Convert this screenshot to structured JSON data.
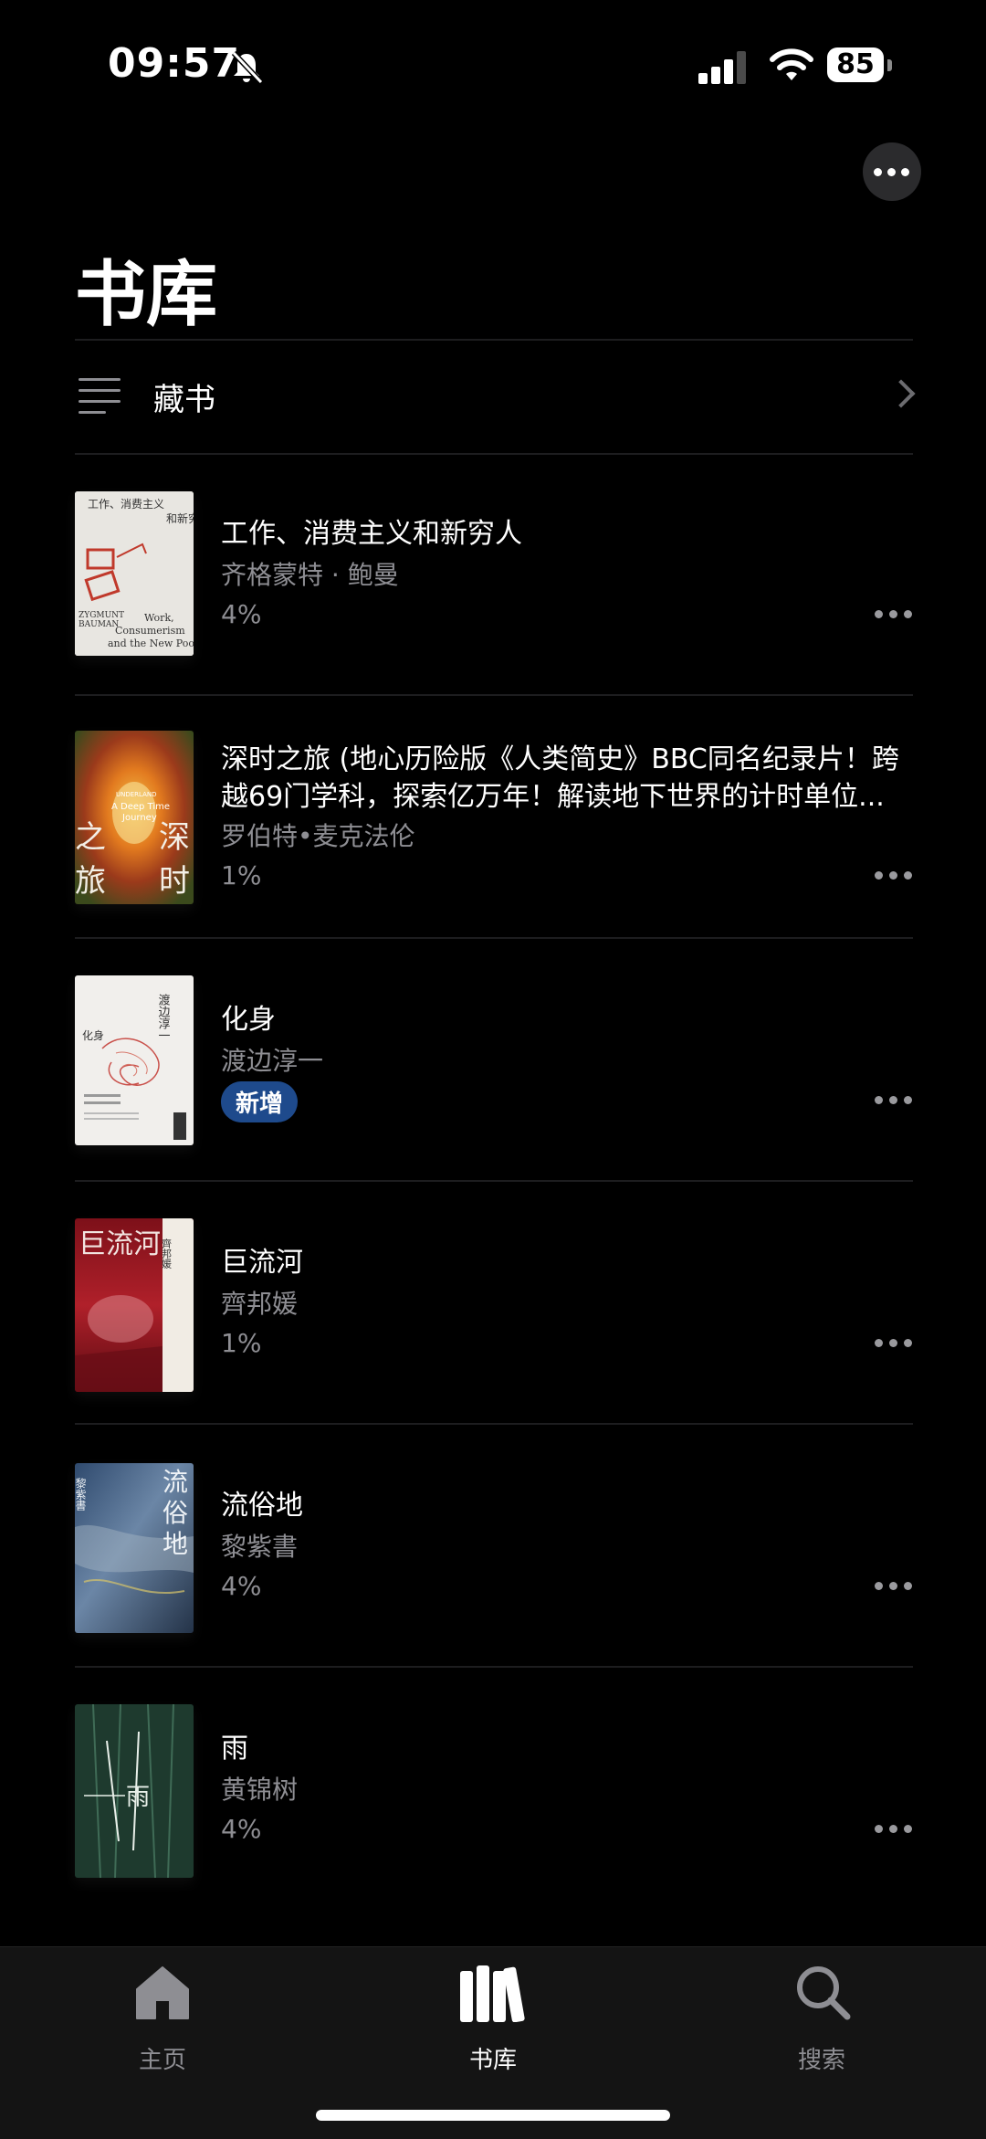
{
  "status": {
    "time": "09:57",
    "battery": "85"
  },
  "page": {
    "title": "书库"
  },
  "collection": {
    "label": "藏书"
  },
  "books": [
    {
      "title": "工作、消费主义和新穷人",
      "author": "齐格蒙特 · 鲍曼",
      "progress": "4%",
      "badge": ""
    },
    {
      "title": "深时之旅 (地心历险版《人类简史》BBC同名纪录片！跨越69门学科，探索亿万年！解读地下世界的计时单位...",
      "author": "罗伯特•麦克法伦",
      "progress": "1%",
      "badge": ""
    },
    {
      "title": "化身",
      "author": "渡边淳一",
      "progress": "",
      "badge": "新增"
    },
    {
      "title": "巨流河",
      "author": "齊邦媛",
      "progress": "1%",
      "badge": ""
    },
    {
      "title": "流俗地",
      "author": "黎紫書",
      "progress": "4%",
      "badge": ""
    },
    {
      "title": "雨",
      "author": "黄锦树",
      "progress": "4%",
      "badge": ""
    }
  ],
  "covers": [
    {
      "lines": [
        "工作、消费主义",
        "和新穷人",
        "ZYGMUNT",
        "BAUMAN",
        "Work,",
        "Consumerism",
        "and the New Poor"
      ]
    },
    {
      "lines": [
        "深",
        "时",
        "之",
        "旅",
        "UNDERLAND",
        "A Deep Time",
        "Journey"
      ]
    },
    {
      "lines": [
        "渡边淳一",
        "化身"
      ]
    },
    {
      "lines": [
        "巨流河",
        "齊邦媛"
      ]
    },
    {
      "lines": [
        "流",
        "俗",
        "地",
        "黎紫書"
      ]
    },
    {
      "lines": [
        "雨"
      ]
    }
  ],
  "tabs": [
    {
      "label": "主页",
      "active": false
    },
    {
      "label": "书库",
      "active": true
    },
    {
      "label": "搜索",
      "active": false
    }
  ],
  "colors": {
    "background": "#000000",
    "secondary_text": "#8e8e93",
    "badge": "#1e4a8c",
    "tabbar": "#141414",
    "inactive_tab": "#8e8e93"
  }
}
